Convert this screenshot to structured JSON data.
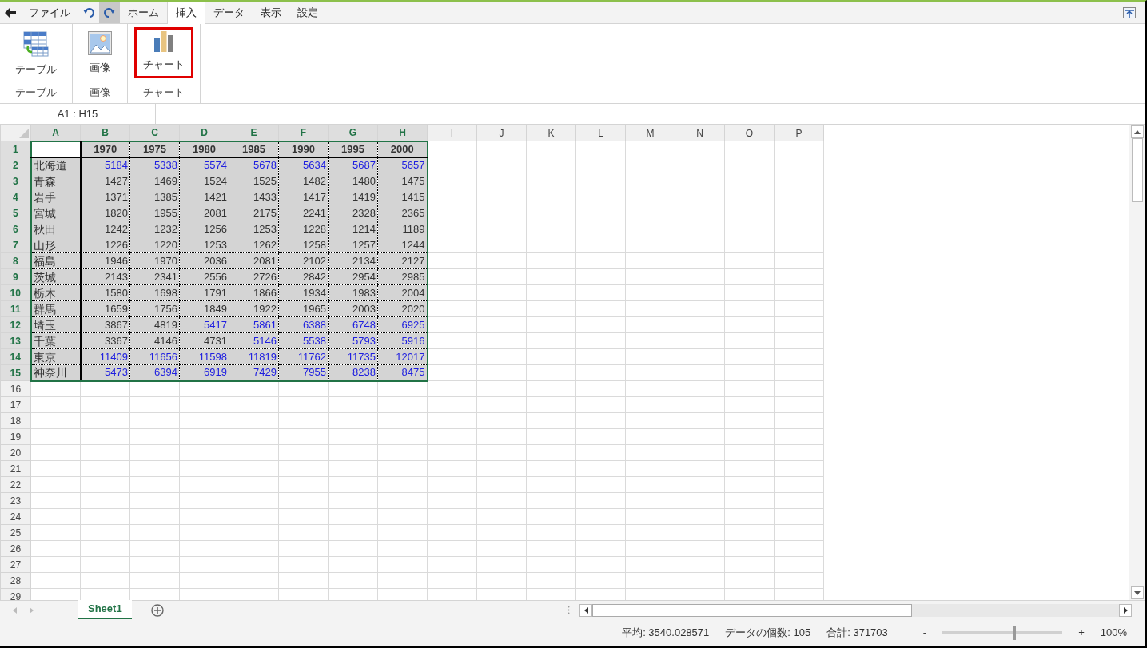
{
  "menu": {
    "items": [
      {
        "kind": "back"
      },
      {
        "kind": "tab",
        "label": "ファイル",
        "selected": false
      },
      {
        "kind": "undo"
      },
      {
        "kind": "redo"
      },
      {
        "kind": "tab",
        "label": "ホーム",
        "selected": false
      },
      {
        "kind": "tab",
        "label": "挿入",
        "selected": true
      },
      {
        "kind": "tab",
        "label": "データ",
        "selected": false
      },
      {
        "kind": "tab",
        "label": "表示",
        "selected": false
      },
      {
        "kind": "tab",
        "label": "設定",
        "selected": false
      }
    ]
  },
  "ribbon": {
    "groups": [
      {
        "label": "テーブル",
        "button": {
          "kind": "table",
          "label": "テーブル",
          "highlighted": false
        }
      },
      {
        "label": "画像",
        "button": {
          "kind": "image",
          "label": "画像",
          "highlighted": false
        }
      },
      {
        "label": "チャート",
        "button": {
          "kind": "chart",
          "label": "チャート",
          "highlighted": true
        }
      }
    ]
  },
  "formula_bar": {
    "name_box": "A1 : H15"
  },
  "sheet": {
    "columns": [
      {
        "label": "A",
        "selected": true
      },
      {
        "label": "B",
        "selected": true
      },
      {
        "label": "C",
        "selected": true
      },
      {
        "label": "D",
        "selected": true
      },
      {
        "label": "E",
        "selected": true
      },
      {
        "label": "F",
        "selected": true
      },
      {
        "label": "G",
        "selected": true
      },
      {
        "label": "H",
        "selected": true
      },
      {
        "label": "I",
        "selected": false
      },
      {
        "label": "J",
        "selected": false
      },
      {
        "label": "K",
        "selected": false
      },
      {
        "label": "L",
        "selected": false
      },
      {
        "label": "M",
        "selected": false
      },
      {
        "label": "N",
        "selected": false
      },
      {
        "label": "O",
        "selected": false
      },
      {
        "label": "P",
        "selected": false
      }
    ],
    "rows": [
      {
        "number": "1",
        "selected": true,
        "kind": "header",
        "cells": [
          {
            "text": "1970",
            "highlighted": false
          },
          {
            "text": "1975",
            "highlighted": false
          },
          {
            "text": "1980",
            "highlighted": false
          },
          {
            "text": "1985",
            "highlighted": false
          },
          {
            "text": "1990",
            "highlighted": false
          },
          {
            "text": "1995",
            "highlighted": false
          },
          {
            "text": "2000",
            "highlighted": false
          }
        ]
      },
      {
        "number": "2",
        "selected": true,
        "kind": "data",
        "label": "北海道",
        "cells": [
          {
            "text": "5184",
            "highlighted": true
          },
          {
            "text": "5338",
            "highlighted": true
          },
          {
            "text": "5574",
            "highlighted": true
          },
          {
            "text": "5678",
            "highlighted": true
          },
          {
            "text": "5634",
            "highlighted": true
          },
          {
            "text": "5687",
            "highlighted": true
          },
          {
            "text": "5657",
            "highlighted": true
          }
        ]
      },
      {
        "number": "3",
        "selected": true,
        "kind": "data",
        "label": "青森",
        "cells": [
          {
            "text": "1427",
            "highlighted": false
          },
          {
            "text": "1469",
            "highlighted": false
          },
          {
            "text": "1524",
            "highlighted": false
          },
          {
            "text": "1525",
            "highlighted": false
          },
          {
            "text": "1482",
            "highlighted": false
          },
          {
            "text": "1480",
            "highlighted": false
          },
          {
            "text": "1475",
            "highlighted": false
          }
        ]
      },
      {
        "number": "4",
        "selected": true,
        "kind": "data",
        "label": "岩手",
        "cells": [
          {
            "text": "1371",
            "highlighted": false
          },
          {
            "text": "1385",
            "highlighted": false
          },
          {
            "text": "1421",
            "highlighted": false
          },
          {
            "text": "1433",
            "highlighted": false
          },
          {
            "text": "1417",
            "highlighted": false
          },
          {
            "text": "1419",
            "highlighted": false
          },
          {
            "text": "1415",
            "highlighted": false
          }
        ]
      },
      {
        "number": "5",
        "selected": true,
        "kind": "data",
        "label": "宮城",
        "cells": [
          {
            "text": "1820",
            "highlighted": false
          },
          {
            "text": "1955",
            "highlighted": false
          },
          {
            "text": "2081",
            "highlighted": false
          },
          {
            "text": "2175",
            "highlighted": false
          },
          {
            "text": "2241",
            "highlighted": false
          },
          {
            "text": "2328",
            "highlighted": false
          },
          {
            "text": "2365",
            "highlighted": false
          }
        ]
      },
      {
        "number": "6",
        "selected": true,
        "kind": "data",
        "label": "秋田",
        "cells": [
          {
            "text": "1242",
            "highlighted": false
          },
          {
            "text": "1232",
            "highlighted": false
          },
          {
            "text": "1256",
            "highlighted": false
          },
          {
            "text": "1253",
            "highlighted": false
          },
          {
            "text": "1228",
            "highlighted": false
          },
          {
            "text": "1214",
            "highlighted": false
          },
          {
            "text": "1189",
            "highlighted": false
          }
        ]
      },
      {
        "number": "7",
        "selected": true,
        "kind": "data",
        "label": "山形",
        "cells": [
          {
            "text": "1226",
            "highlighted": false
          },
          {
            "text": "1220",
            "highlighted": false
          },
          {
            "text": "1253",
            "highlighted": false
          },
          {
            "text": "1262",
            "highlighted": false
          },
          {
            "text": "1258",
            "highlighted": false
          },
          {
            "text": "1257",
            "highlighted": false
          },
          {
            "text": "1244",
            "highlighted": false
          }
        ]
      },
      {
        "number": "8",
        "selected": true,
        "kind": "data",
        "label": "福島",
        "cells": [
          {
            "text": "1946",
            "highlighted": false
          },
          {
            "text": "1970",
            "highlighted": false
          },
          {
            "text": "2036",
            "highlighted": false
          },
          {
            "text": "2081",
            "highlighted": false
          },
          {
            "text": "2102",
            "highlighted": false
          },
          {
            "text": "2134",
            "highlighted": false
          },
          {
            "text": "2127",
            "highlighted": false
          }
        ]
      },
      {
        "number": "9",
        "selected": true,
        "kind": "data",
        "label": "茨城",
        "cells": [
          {
            "text": "2143",
            "highlighted": false
          },
          {
            "text": "2341",
            "highlighted": false
          },
          {
            "text": "2556",
            "highlighted": false
          },
          {
            "text": "2726",
            "highlighted": false
          },
          {
            "text": "2842",
            "highlighted": false
          },
          {
            "text": "2954",
            "highlighted": false
          },
          {
            "text": "2985",
            "highlighted": false
          }
        ]
      },
      {
        "number": "10",
        "selected": true,
        "kind": "data",
        "label": "栃木",
        "cells": [
          {
            "text": "1580",
            "highlighted": false
          },
          {
            "text": "1698",
            "highlighted": false
          },
          {
            "text": "1791",
            "highlighted": false
          },
          {
            "text": "1866",
            "highlighted": false
          },
          {
            "text": "1934",
            "highlighted": false
          },
          {
            "text": "1983",
            "highlighted": false
          },
          {
            "text": "2004",
            "highlighted": false
          }
        ]
      },
      {
        "number": "11",
        "selected": true,
        "kind": "data",
        "label": "群馬",
        "cells": [
          {
            "text": "1659",
            "highlighted": false
          },
          {
            "text": "1756",
            "highlighted": false
          },
          {
            "text": "1849",
            "highlighted": false
          },
          {
            "text": "1922",
            "highlighted": false
          },
          {
            "text": "1965",
            "highlighted": false
          },
          {
            "text": "2003",
            "highlighted": false
          },
          {
            "text": "2020",
            "highlighted": false
          }
        ]
      },
      {
        "number": "12",
        "selected": true,
        "kind": "data",
        "label": "埼玉",
        "cells": [
          {
            "text": "3867",
            "highlighted": false
          },
          {
            "text": "4819",
            "highlighted": false
          },
          {
            "text": "5417",
            "highlighted": true
          },
          {
            "text": "5861",
            "highlighted": true
          },
          {
            "text": "6388",
            "highlighted": true
          },
          {
            "text": "6748",
            "highlighted": true
          },
          {
            "text": "6925",
            "highlighted": true
          }
        ]
      },
      {
        "number": "13",
        "selected": true,
        "kind": "data",
        "label": "千葉",
        "cells": [
          {
            "text": "3367",
            "highlighted": false
          },
          {
            "text": "4146",
            "highlighted": false
          },
          {
            "text": "4731",
            "highlighted": false
          },
          {
            "text": "5146",
            "highlighted": true
          },
          {
            "text": "5538",
            "highlighted": true
          },
          {
            "text": "5793",
            "highlighted": true
          },
          {
            "text": "5916",
            "highlighted": true
          }
        ]
      },
      {
        "number": "14",
        "selected": true,
        "kind": "data",
        "label": "東京",
        "cells": [
          {
            "text": "11409",
            "highlighted": true
          },
          {
            "text": "11656",
            "highlighted": true
          },
          {
            "text": "11598",
            "highlighted": true
          },
          {
            "text": "11819",
            "highlighted": true
          },
          {
            "text": "11762",
            "highlighted": true
          },
          {
            "text": "11735",
            "highlighted": true
          },
          {
            "text": "12017",
            "highlighted": true
          }
        ]
      },
      {
        "number": "15",
        "selected": true,
        "kind": "data",
        "label": "神奈川",
        "cells": [
          {
            "text": "5473",
            "highlighted": true
          },
          {
            "text": "6394",
            "highlighted": true
          },
          {
            "text": "6919",
            "highlighted": true
          },
          {
            "text": "7429",
            "highlighted": true
          },
          {
            "text": "7955",
            "highlighted": true
          },
          {
            "text": "8238",
            "highlighted": true
          },
          {
            "text": "8475",
            "highlighted": true
          }
        ]
      },
      {
        "number": "16",
        "selected": false,
        "kind": "empty"
      },
      {
        "number": "17",
        "selected": false,
        "kind": "empty"
      },
      {
        "number": "18",
        "selected": false,
        "kind": "empty"
      },
      {
        "number": "19",
        "selected": false,
        "kind": "empty"
      },
      {
        "number": "20",
        "selected": false,
        "kind": "empty"
      },
      {
        "number": "21",
        "selected": false,
        "kind": "empty"
      },
      {
        "number": "22",
        "selected": false,
        "kind": "empty"
      },
      {
        "number": "23",
        "selected": false,
        "kind": "empty"
      },
      {
        "number": "24",
        "selected": false,
        "kind": "empty"
      },
      {
        "number": "25",
        "selected": false,
        "kind": "empty"
      },
      {
        "number": "26",
        "selected": false,
        "kind": "empty"
      },
      {
        "number": "27",
        "selected": false,
        "kind": "empty"
      },
      {
        "number": "28",
        "selected": false,
        "kind": "empty"
      },
      {
        "number": "29",
        "selected": false,
        "kind": "empty"
      }
    ]
  },
  "sheet_tabs": [
    {
      "label": "Sheet1",
      "selected": true
    }
  ],
  "status_bar": {
    "average": "平均: 3540.028571",
    "count": "データの個数: 105",
    "sum": "合計: 371703",
    "zoom": {
      "minus": "-",
      "plus": "+",
      "level": 0.6,
      "reading": "100%"
    }
  }
}
